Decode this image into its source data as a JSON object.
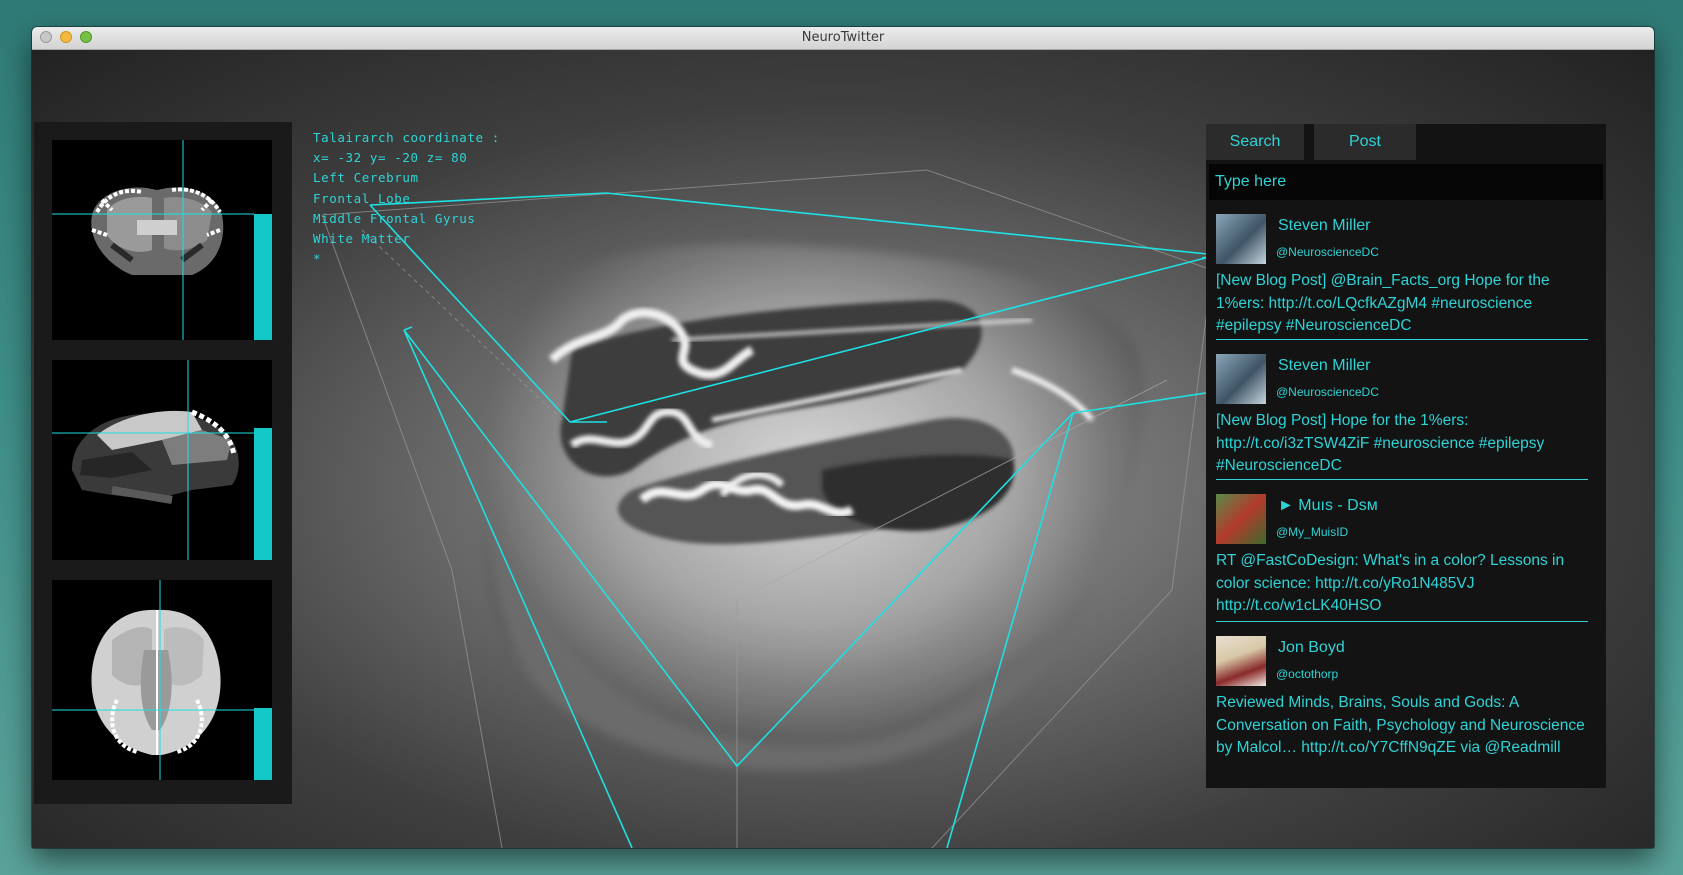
{
  "window": {
    "title": "NeuroTwitter"
  },
  "info": {
    "lines": [
      "Talairarch coordinate :",
      "x= -32 y= -20 z= 80",
      "Left Cerebrum",
      "Frontal Lobe",
      "Middle Frontal Gyrus",
      "White Matter",
      "*"
    ]
  },
  "slices": [
    {
      "view": "coronal",
      "level": 0.63
    },
    {
      "view": "sagittal",
      "level": 0.66
    },
    {
      "view": "axial",
      "level": 0.36
    }
  ],
  "twitter": {
    "tabs": [
      "Search",
      "Post"
    ],
    "search_placeholder": "Type here",
    "tweets": [
      {
        "name": "Steven Miller",
        "handle": "@NeuroscienceDC",
        "text": "[New Blog Post] @Brain_Facts_org Hope for the 1%ers: http://t.co/LQcfkAZgM4 #neuroscience #epilepsy #NeuroscienceDC"
      },
      {
        "name": "Steven Miller",
        "handle": "@NeuroscienceDC",
        "text": "[New Blog Post] Hope for the 1%ers: http://t.co/i3zTSW4ZiF #neuroscience #epilepsy #NeuroscienceDC"
      },
      {
        "name": "► Muıs - Dsм",
        "handle": "@My_MuisID",
        "text": "RT @FastCoDesign: What's in a color? Lessons in color science: http://t.co/yRo1N485VJ http://t.co/w1cLK40HSO"
      },
      {
        "name": "Jon Boyd",
        "handle": "@octothorp",
        "text": "Reviewed Minds, Brains, Souls and Gods: A Conversation on Faith, Psychology and Neuroscience by Malcol… http://t.co/Y7CffN9qZE via @Readmill"
      }
    ]
  },
  "colors": {
    "accent": "#2ed3d6"
  }
}
